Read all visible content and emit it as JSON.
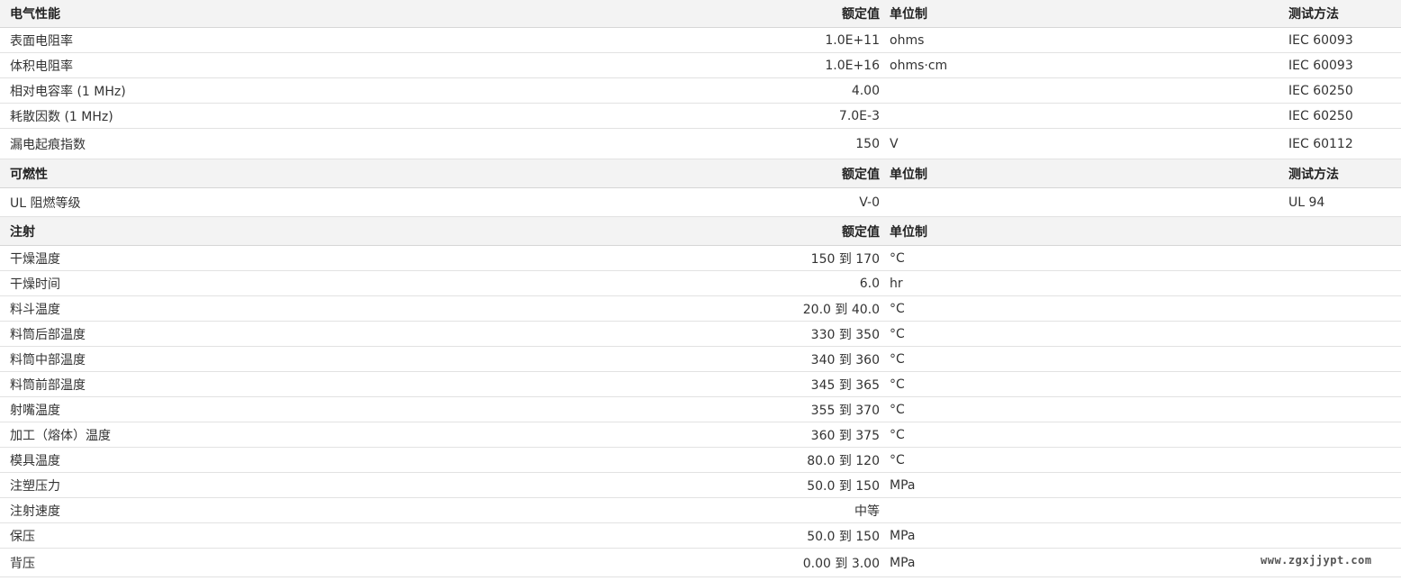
{
  "sections": [
    {
      "title": "电气性能",
      "col_value": "额定值",
      "col_unit": "单位制",
      "col_test": "测试方法",
      "rows": [
        {
          "name": "表面电阻率",
          "value": "1.0E+11",
          "unit": "ohms",
          "test": "IEC 60093"
        },
        {
          "name": "体积电阻率",
          "value": "1.0E+16",
          "unit": "ohms·cm",
          "test": "IEC 60093"
        },
        {
          "name": "相对电容率 (1 MHz)",
          "value": "4.00",
          "unit": "",
          "test": "IEC 60250"
        },
        {
          "name": "耗散因数 (1 MHz)",
          "value": "7.0E-3",
          "unit": "",
          "test": "IEC 60250"
        },
        {
          "name": "漏电起痕指数",
          "value": "150",
          "unit": "V",
          "test": "IEC 60112"
        }
      ]
    },
    {
      "title": "可燃性",
      "col_value": "额定值",
      "col_unit": "单位制",
      "col_test": "测试方法",
      "rows": [
        {
          "name": "UL 阻燃等级",
          "value": "V-0",
          "unit": "",
          "test": "UL 94"
        }
      ]
    },
    {
      "title": "注射",
      "col_value": "额定值",
      "col_unit": "单位制",
      "col_test": "",
      "rows": [
        {
          "name": "干燥温度",
          "value": "150 到 170",
          "unit": "°C",
          "test": ""
        },
        {
          "name": "干燥时间",
          "value": "6.0",
          "unit": "hr",
          "test": ""
        },
        {
          "name": "料斗温度",
          "value": "20.0 到 40.0",
          "unit": "°C",
          "test": ""
        },
        {
          "name": "料筒后部温度",
          "value": "330 到 350",
          "unit": "°C",
          "test": ""
        },
        {
          "name": "料筒中部温度",
          "value": "340 到 360",
          "unit": "°C",
          "test": ""
        },
        {
          "name": "料筒前部温度",
          "value": "345 到 365",
          "unit": "°C",
          "test": ""
        },
        {
          "name": "射嘴温度",
          "value": "355 到 370",
          "unit": "°C",
          "test": ""
        },
        {
          "name": "加工（熔体）温度",
          "value": "360 到 375",
          "unit": "°C",
          "test": ""
        },
        {
          "name": "模具温度",
          "value": "80.0 到 120",
          "unit": "°C",
          "test": ""
        },
        {
          "name": "注塑压力",
          "value": "50.0 到 150",
          "unit": "MPa",
          "test": ""
        },
        {
          "name": "注射速度",
          "value": "中等",
          "unit": "",
          "test": ""
        },
        {
          "name": "保压",
          "value": "50.0 到 150",
          "unit": "MPa",
          "test": ""
        },
        {
          "name": "背压",
          "value": "0.00 到 3.00",
          "unit": "MPa",
          "test": ""
        }
      ]
    }
  ],
  "watermark": "www.zgxjjypt.com"
}
